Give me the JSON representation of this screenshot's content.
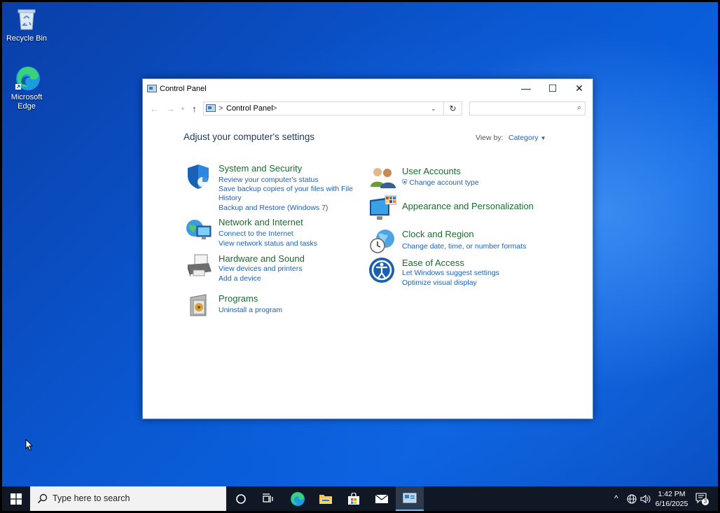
{
  "desktop": {
    "icons": [
      {
        "label": "Recycle Bin"
      },
      {
        "label": "Microsoft Edge"
      }
    ]
  },
  "window": {
    "title": "Control Panel",
    "controls": {
      "minimize": "—",
      "maximize": "☐",
      "close": "✕"
    },
    "address": {
      "crumbs": [
        "Control Panel"
      ],
      "sep": ">"
    },
    "search": {
      "value": "",
      "placeholder": ""
    }
  },
  "content": {
    "heading": "Adjust your computer's settings",
    "view_by_label": "View by:",
    "view_by_value": "Category",
    "left_categories": [
      {
        "title": "System and Security",
        "links": [
          "Review your computer's status",
          "Save backup copies of your files with File",
          "History",
          "Backup and Restore (Windows 7)"
        ]
      },
      {
        "title": "Network and Internet",
        "links": [
          "Connect to the Internet",
          "View network status and tasks"
        ]
      },
      {
        "title": "Hardware and Sound",
        "links": [
          "View devices and printers",
          "Add a device"
        ]
      },
      {
        "title": "Programs",
        "links": [
          "Uninstall a program"
        ]
      }
    ],
    "right_categories": [
      {
        "title": "User Accounts",
        "links": [
          "Change account type"
        ]
      },
      {
        "title": "Appearance and Personalization",
        "links": []
      },
      {
        "title": "Clock and Region",
        "links": [
          "Change date, time, or number formats"
        ]
      },
      {
        "title": "Ease of Access",
        "links": [
          "Let Windows suggest settings",
          "Optimize visual display"
        ]
      }
    ]
  },
  "taskbar": {
    "search_placeholder": "Type here to search",
    "time": "1:42 PM",
    "date": "6/16/2025",
    "notification_count": "3"
  },
  "colors": {
    "category_title": "#1d6a2e",
    "link": "#1e61b4",
    "accent": "#0a58d2"
  }
}
